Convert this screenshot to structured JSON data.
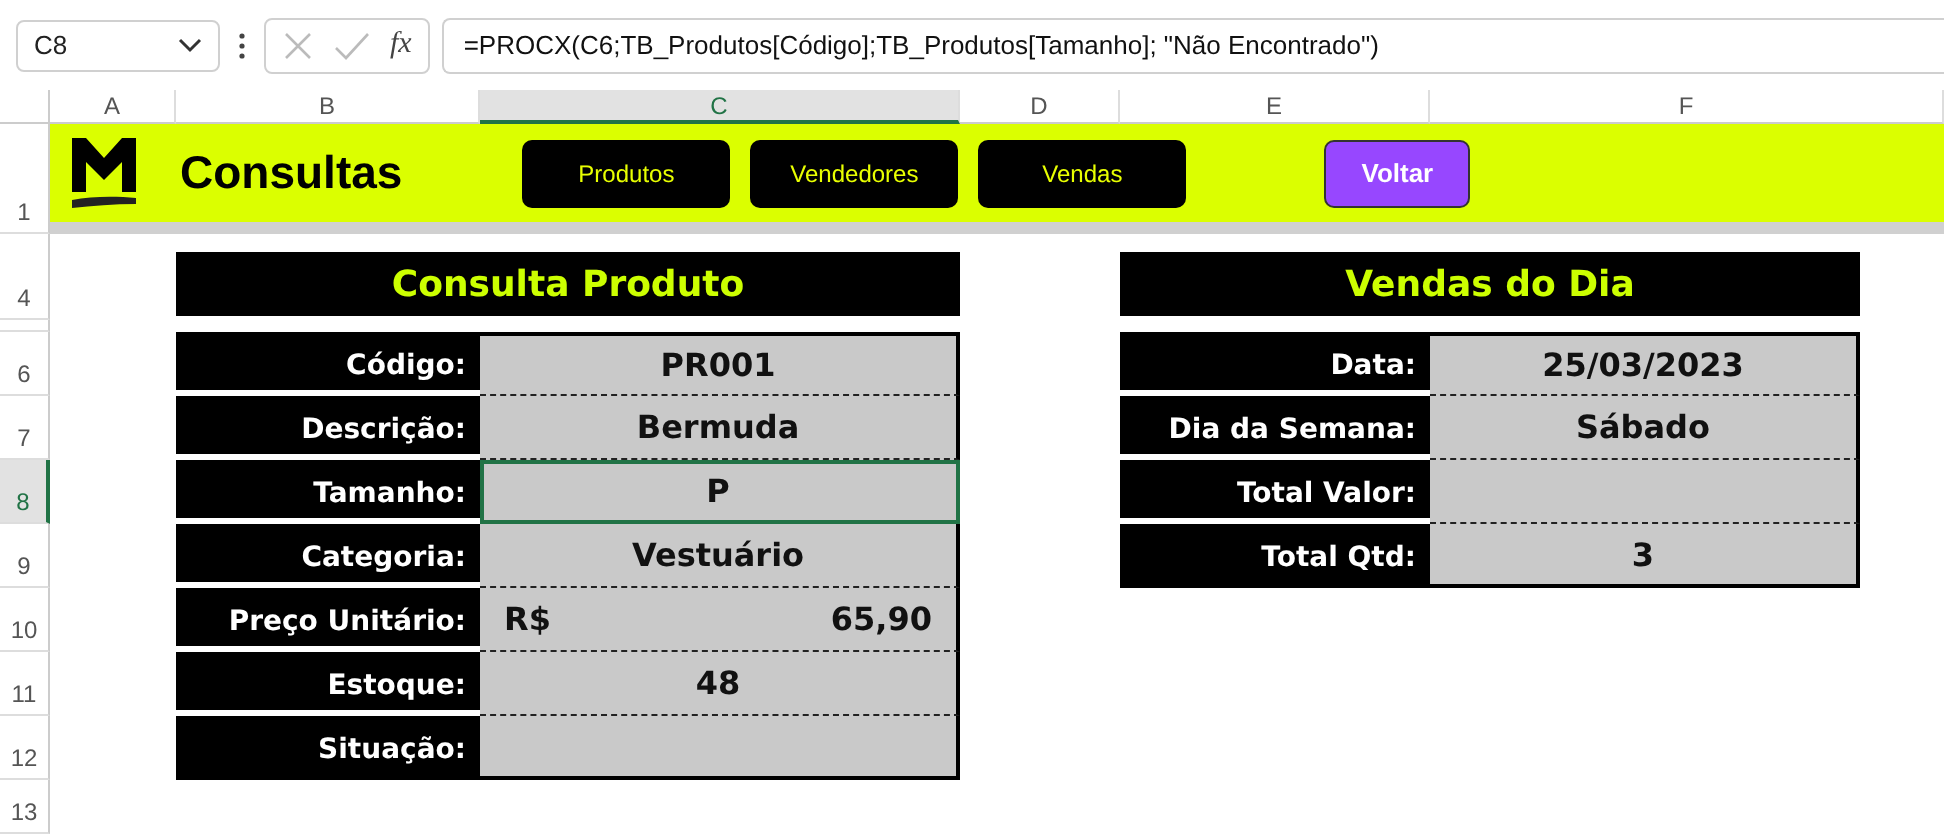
{
  "name_box": {
    "value": "C8"
  },
  "formula_bar": {
    "fx_label": "fx",
    "formula": "=PROCX(C6;TB_Produtos[Código];TB_Produtos[Tamanho]; \"Não Encontrado\")"
  },
  "columns": [
    {
      "label": "A",
      "selected": false
    },
    {
      "label": "B",
      "selected": false
    },
    {
      "label": "C",
      "selected": true
    },
    {
      "label": "D",
      "selected": false
    },
    {
      "label": "E",
      "selected": false
    },
    {
      "label": "F",
      "selected": false
    }
  ],
  "rows": [
    {
      "label": "1",
      "selected": false
    },
    {
      "label": "4",
      "selected": false
    },
    {
      "label": "6",
      "selected": false
    },
    {
      "label": "7",
      "selected": false
    },
    {
      "label": "8",
      "selected": true
    },
    {
      "label": "9",
      "selected": false
    },
    {
      "label": "10",
      "selected": false
    },
    {
      "label": "11",
      "selected": false
    },
    {
      "label": "12",
      "selected": false
    },
    {
      "label": "13",
      "selected": false
    }
  ],
  "header": {
    "title": "Consultas",
    "nav_buttons": [
      "Produtos",
      "Vendedores",
      "Vendas"
    ],
    "back_button": "Voltar"
  },
  "consulta_produto": {
    "title": "Consulta Produto",
    "fields": [
      {
        "label": "Código:",
        "kind": "text",
        "value": "PR001",
        "selected": false
      },
      {
        "label": "Descrição:",
        "kind": "text",
        "value": "Bermuda",
        "selected": false
      },
      {
        "label": "Tamanho:",
        "kind": "text",
        "value": "P",
        "selected": true
      },
      {
        "label": "Categoria:",
        "kind": "text",
        "value": "Vestuário",
        "selected": false
      },
      {
        "label": "Preço Unitário:",
        "kind": "currency",
        "currency": "R$",
        "value": "65,90",
        "selected": false
      },
      {
        "label": "Estoque:",
        "kind": "text",
        "value": "48",
        "selected": false
      },
      {
        "label": "Situação:",
        "kind": "text",
        "selected": false
      }
    ]
  },
  "vendas_do_dia": {
    "title": "Vendas do Dia",
    "fields": [
      {
        "label": "Data:",
        "kind": "text",
        "value": "25/03/2023"
      },
      {
        "label": "Dia da Semana:",
        "kind": "text",
        "value": "Sábado"
      },
      {
        "label": "Total Valor:",
        "kind": "text"
      },
      {
        "label": "Total Qtd:",
        "kind": "text",
        "value": "3"
      }
    ]
  }
}
